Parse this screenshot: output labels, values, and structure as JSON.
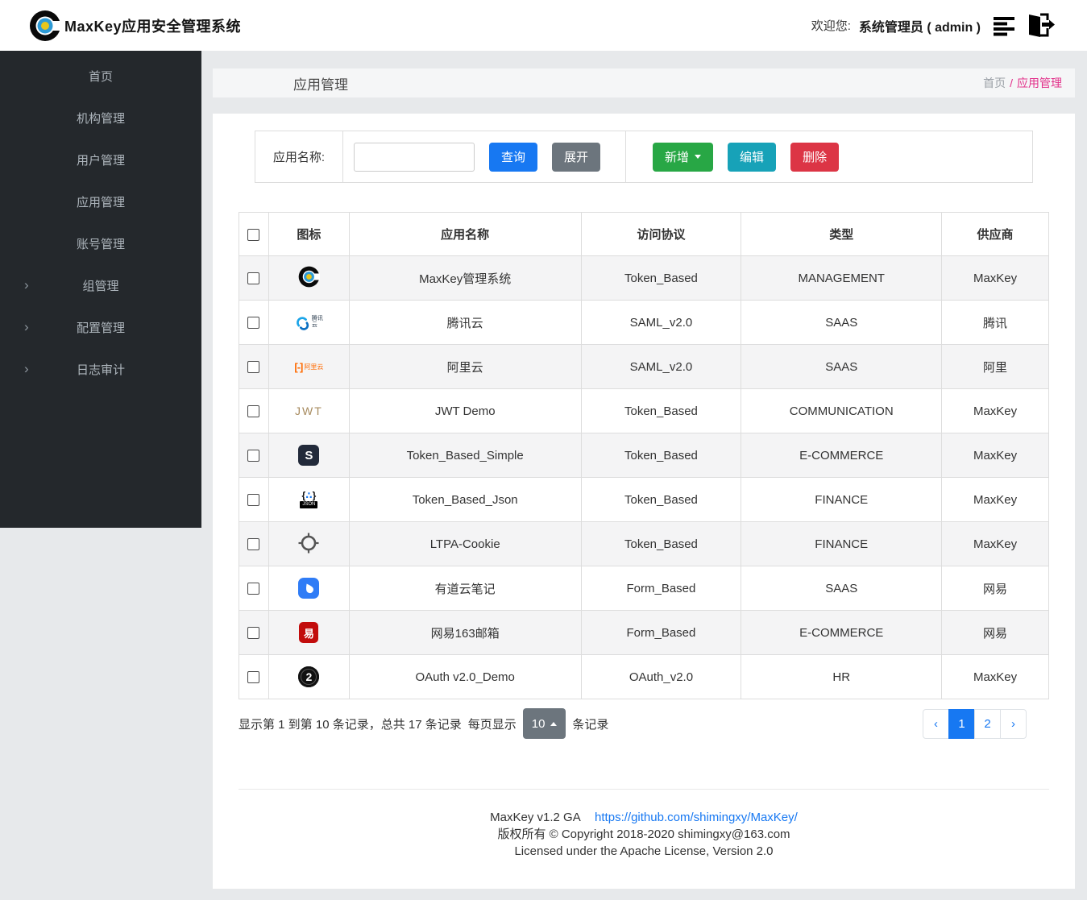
{
  "header": {
    "title": "MaxKey应用安全管理系统",
    "welcome_label": "欢迎您:",
    "user": "系统管理员 ( admin )",
    "icons": [
      "maxkey-logo-icon",
      "list-icon",
      "logout-icon"
    ]
  },
  "sidebar": {
    "items": [
      {
        "id": "home",
        "label": "首页",
        "has_children": false
      },
      {
        "id": "org",
        "label": "机构管理",
        "has_children": false
      },
      {
        "id": "user",
        "label": "用户管理",
        "has_children": false
      },
      {
        "id": "app",
        "label": "应用管理",
        "has_children": false
      },
      {
        "id": "account",
        "label": "账号管理",
        "has_children": false
      },
      {
        "id": "group",
        "label": "组管理",
        "has_children": true
      },
      {
        "id": "config",
        "label": "配置管理",
        "has_children": true
      },
      {
        "id": "audit",
        "label": "日志审计",
        "has_children": true
      }
    ]
  },
  "breadcrumb": {
    "page_title": "应用管理",
    "home": "首页",
    "separator": "/",
    "current": "应用管理"
  },
  "search": {
    "label": "应用名称:",
    "input_value": "",
    "query": "查询",
    "expand": "展开",
    "add": "新增",
    "edit": "编辑",
    "delete": "删除"
  },
  "table": {
    "headers": [
      "图标",
      "应用名称",
      "访问协议",
      "类型",
      "供应商"
    ],
    "rows": [
      {
        "icon": "maxkey-icon",
        "name": "MaxKey管理系统",
        "protocol": "Token_Based",
        "type": "MANAGEMENT",
        "vendor": "MaxKey"
      },
      {
        "icon": "tencent-cloud-icon",
        "name": "腾讯云",
        "protocol": "SAML_v2.0",
        "type": "SAAS",
        "vendor": "腾讯"
      },
      {
        "icon": "aliyun-icon",
        "name": "阿里云",
        "protocol": "SAML_v2.0",
        "type": "SAAS",
        "vendor": "阿里"
      },
      {
        "icon": "jwt-icon",
        "name": "JWT Demo",
        "protocol": "Token_Based",
        "type": "COMMUNICATION",
        "vendor": "MaxKey"
      },
      {
        "icon": "simple-s-icon",
        "name": "Token_Based_Simple",
        "protocol": "Token_Based",
        "type": "E-COMMERCE",
        "vendor": "MaxKey"
      },
      {
        "icon": "json-icon",
        "name": "Token_Based_Json",
        "protocol": "Token_Based",
        "type": "FINANCE",
        "vendor": "MaxKey"
      },
      {
        "icon": "ltpa-crosshair-icon",
        "name": "LTPA-Cookie",
        "protocol": "Token_Based",
        "type": "FINANCE",
        "vendor": "MaxKey"
      },
      {
        "icon": "youdao-note-icon",
        "name": "有道云笔记",
        "protocol": "Form_Based",
        "type": "SAAS",
        "vendor": "网易"
      },
      {
        "icon": "netease-163-icon",
        "name": "网易163邮箱",
        "protocol": "Form_Based",
        "type": "E-COMMERCE",
        "vendor": "网易"
      },
      {
        "icon": "oauth2-icon",
        "name": "OAuth v2.0_Demo",
        "protocol": "OAuth_v2.0",
        "type": "HR",
        "vendor": "MaxKey"
      }
    ]
  },
  "pagination": {
    "info": "显示第 1 到第 10 条记录，总共 17 条记录",
    "per_page_label": "每页显示",
    "page_size": "10",
    "suffix": "条记录",
    "pages": [
      "‹",
      "1",
      "2",
      "›"
    ],
    "active_page": "1"
  },
  "footer": {
    "version": "MaxKey  v1.2 GA",
    "link": "https://github.com/shimingxy/MaxKey/",
    "copyright": "版权所有 © Copyright 2018-2020 shimingxy@163.com",
    "license": "Licensed under the Apache License, Version 2.0"
  },
  "colors": {
    "primary_blue": "#1778f2",
    "green": "#28a745",
    "teal": "#17a2b8",
    "red": "#dc3545",
    "grey_button": "#6c757d",
    "sidebar_bg": "#24282c",
    "breadcrumb_pink": "#e2308a",
    "stripe_row": "#f4f4f5",
    "page_bg": "#e7e9eb"
  }
}
